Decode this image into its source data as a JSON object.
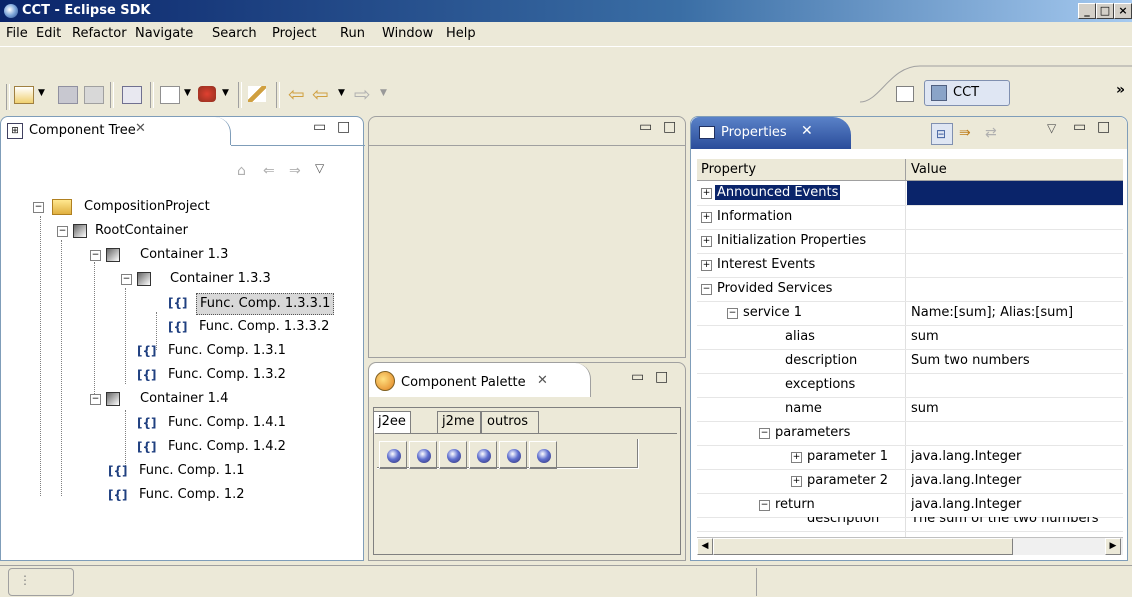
{
  "window": {
    "title": "CCT - Eclipse SDK"
  },
  "menu": [
    "File",
    "Edit",
    "Refactor",
    "Navigate",
    "Search",
    "Project",
    "Run",
    "Window",
    "Help"
  ],
  "perspective": {
    "label": "CCT"
  },
  "component_tree": {
    "tab_label": "Component Tree",
    "nodes": [
      "CompositionProject",
      "RootContainer",
      "Container 1.3",
      "Container 1.3.3",
      "Func. Comp. 1.3.3.1",
      "Func. Comp. 1.3.3.2",
      "Func. Comp. 1.3.1",
      "Func. Comp. 1.3.2",
      "Container 1.4",
      "Func. Comp. 1.4.1",
      "Func. Comp. 1.4.2",
      "Func. Comp. 1.1",
      "Func. Comp. 1.2"
    ]
  },
  "palette": {
    "tab_label": "Component Palette",
    "tabs": [
      "j2ee",
      "j2me",
      "outros"
    ]
  },
  "properties": {
    "tab_label": "Properties",
    "col_property": "Property",
    "col_value": "Value",
    "rows": [
      {
        "name": "Announced Events",
        "value": ""
      },
      {
        "name": "Information",
        "value": ""
      },
      {
        "name": "Initialization Properties",
        "value": ""
      },
      {
        "name": "Interest Events",
        "value": ""
      },
      {
        "name": "Provided Services",
        "value": ""
      },
      {
        "name": "service 1",
        "value": "Name:[sum]; Alias:[sum]"
      },
      {
        "name": "alias",
        "value": "sum"
      },
      {
        "name": "description",
        "value": "Sum two numbers"
      },
      {
        "name": "exceptions",
        "value": ""
      },
      {
        "name": "name",
        "value": "sum"
      },
      {
        "name": "parameters",
        "value": ""
      },
      {
        "name": "parameter 1",
        "value": "java.lang.Integer"
      },
      {
        "name": "parameter 2",
        "value": "java.lang.Integer"
      },
      {
        "name": "return",
        "value": "java.lang.Integer"
      },
      {
        "name": "description",
        "value": "The sum of the two numbers"
      }
    ]
  }
}
